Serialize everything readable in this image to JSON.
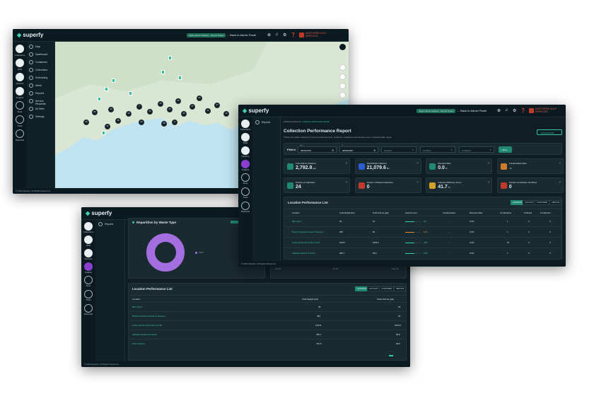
{
  "brand": "superfy",
  "colors": {
    "accent": "#3fd1a8",
    "purple": "#8a3fd1",
    "bg": "#0f1e24"
  },
  "w1": {
    "pill": "Super Admin Session · Ernest Tenius",
    "back": "Back to Admin Panel",
    "org_name_1": "NORTHERN GULF",
    "org_name_2": "SERVICES",
    "rail": [
      "Collections",
      "DSH",
      "Devices",
      "Insights",
      "Fleet",
      "Track",
      "Materials"
    ],
    "nav": [
      "Map",
      "Dashboard",
      "Containers",
      "Collections",
      "Scheduling",
      "Alerts",
      "Reports",
      "Service Requests",
      "All Sites",
      "Settings"
    ],
    "footer": "© 2024 Superfy. All Rights Reserved.",
    "clusters": [
      "28",
      "54",
      "12",
      "28",
      "13",
      "7",
      "21",
      "24",
      "31",
      "26",
      "19",
      "27",
      "30",
      "11",
      "17",
      "14",
      "9",
      "18",
      "22",
      "32"
    ]
  },
  "w2": {
    "breadcrumb_1": "Dashboard Reports",
    "breadcrumb_2": "Collection Performance Report",
    "pill": "Super Admin Session · Ernest Tenius",
    "back": "Back to Admin Panel",
    "org_name_1": "NORTHERN GULF",
    "org_name_2": "SERVICES",
    "nav_reports": "Reports",
    "title": "Collection Performance Report",
    "subtitle": "Tracks key waste collection metrics across accounts, locations, containers and services over a selected date range.",
    "download": "Download PDF",
    "filters_label": "Filters",
    "from_label": "From",
    "to_label": "To",
    "from": "08/06/2025",
    "to": "08/08/2025",
    "f_account": "Account",
    "f_location": "Location",
    "f_container": "Container",
    "more": "+ More",
    "kpis": [
      {
        "label": "Total Volume Collected",
        "value": "2,792.8",
        "unit": "gal",
        "color": "#1f8a6f"
      },
      {
        "label": "Total Weight Collected",
        "value": "21,079.6",
        "unit": "lbs",
        "color": "#2a5bd1"
      },
      {
        "label": "Diversion Rate",
        "value": "0.0",
        "unit": "%",
        "color": "#1f8a6f"
      },
      {
        "label": "Contamination Rate",
        "value": "",
        "unit": "%",
        "color": "#d17a2a"
      },
      {
        "label": "Number of Collections",
        "value": "24",
        "unit": "",
        "color": "#1f8a6f"
      },
      {
        "label": "Number of Missed Collections",
        "value": "0",
        "unit": "",
        "color": "#c0392b"
      },
      {
        "label": "Collection Efficiency Score",
        "value": "41.7",
        "unit": "%",
        "color": "#d1a12a"
      },
      {
        "label": "Number of Collection Overflows",
        "value": "0",
        "unit": "",
        "color": "#c0392b"
      }
    ],
    "table_title": "Location Performance List",
    "tabs": [
      "LOCATION",
      "ACCOUNT",
      "CONTAINER",
      "SERVICE"
    ],
    "columns": [
      "Location",
      "Total Weight (lbs)",
      "Total Volume (gal)",
      "Avg Fill Level",
      "Contamination",
      "Diversion Rate",
      "# Collections",
      "# Missed",
      "# Collection ..."
    ],
    "rows": [
      {
        "name": "Blue Moon",
        "weight": "39",
        "volume": "34",
        "fill": 0.04,
        "fill_label": "4%",
        "fill_color": "#2bd19a",
        "cont": "-",
        "div": "0.0%",
        "col": "1",
        "miss": "0",
        "over": "0"
      },
      {
        "name": "Bristol's Seafood House & Steamer",
        "weight": "465",
        "volume": "60",
        "fill": 0.61,
        "fill_label": "61%",
        "fill_color": "#e88a2a",
        "cont": "-",
        "div": "0.0%",
        "col": "1",
        "miss": "0",
        "over": "0"
      },
      {
        "name": "Funky Monks Sports Bar & Grill",
        "weight": "19373",
        "volume": "2346.6",
        "fill": 0.44,
        "fill_label": "44%",
        "fill_color": "#2bd19a",
        "cont": "-",
        "div": "0.0%",
        "col": "20",
        "miss": "0",
        "over": "0"
      },
      {
        "name": "Jalisidas Seafood & Sushi",
        "weight": "465.1",
        "volume": "59.8",
        "fill": 0.23,
        "fill_label": "23%",
        "fill_color": "#2bd19a",
        "cont": "-",
        "div": "0.0%",
        "col": "1",
        "miss": "0",
        "over": "0"
      }
    ],
    "footer": "© 2024 Superfy. All Rights Reserved."
  },
  "w3": {
    "nav_reports": "Reports",
    "rail": [
      "Collections",
      "DSH",
      "Devices",
      "Insights",
      "Fleet",
      "Track",
      "Materials"
    ],
    "chart_title": "Repartition by Waste Type",
    "legend": "UCO",
    "axis_dates": [
      "Jul 28",
      "Jul 30",
      "Aug 05"
    ],
    "table_title": "Location Performance List",
    "tabs": [
      "LOCATION",
      "ACCOUNT",
      "CONTAINER",
      "SERVICE"
    ],
    "columns": [
      "Location",
      "Total Weight (lbs)",
      "Total Volume (gal)"
    ],
    "rows": [
      {
        "name": "Blue Moon",
        "weight": "39",
        "volume": "34"
      },
      {
        "name": "Bristol's Seafood House & Steamer",
        "weight": "465",
        "volume": "60"
      },
      {
        "name": "Funky Monks Sports Bar & Grill",
        "weight": "19373",
        "volume": "2346.6"
      },
      {
        "name": "Jalisidas Seafood & Sushi",
        "weight": "465.1",
        "volume": "59.8"
      },
      {
        "name": "Petrol Xpress",
        "weight": "732.6",
        "volume": "93.6"
      }
    ],
    "footer": "© 2024 Superfy. All Rights Reserved."
  }
}
